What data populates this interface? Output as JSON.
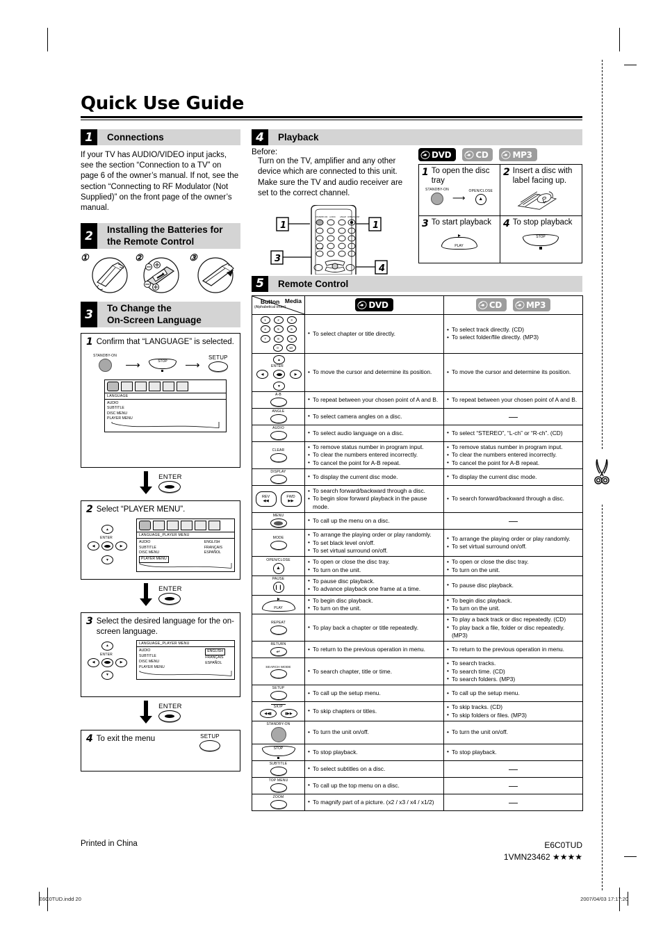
{
  "document": {
    "title": "Quick Use Guide",
    "footer_left": "Printed in China",
    "footer_model": "E6C0TUD",
    "footer_code": "1VMN23462 ★★★★",
    "print_file": "E6C0TUD.indd   20",
    "print_stamp": "2007/04/03   17:17:20"
  },
  "sections": {
    "connections": {
      "number": "1",
      "title": "Connections",
      "body": "If your TV has AUDIO/VIDEO input jacks, see the section “Connection to a TV” on page 6 of the owner’s manual. If not, see the section “Connecting to RF Modulator (Not Supplied)” on the front page of the owner’s manual."
    },
    "batteries": {
      "number": "2",
      "title_line1": "Installing the Batteries for",
      "title_line2": "the Remote Control",
      "steps": [
        "①",
        "②",
        "③"
      ]
    },
    "language": {
      "number": "3",
      "title_line1": "To Change the",
      "title_line2": "On-Screen Language",
      "step1": {
        "n": "1",
        "text": "Confirm that “LANGUAGE” is selected.",
        "key_standby": "STANDBY-ON",
        "key_stop": "STOP",
        "key_setup": "SETUP",
        "osd_bar": "LANGUAGE",
        "osd_items": [
          "AUDIO",
          "SUBTITLE",
          "DISC MENU",
          "PLAYER MENU"
        ]
      },
      "connector1": "ENTER",
      "step2": {
        "n": "2",
        "text": "Select “PLAYER MENU”.",
        "nav_enter": "ENTER",
        "osd_bar": "LANGUAGE_PLAYER MENU",
        "osd_items": [
          "AUDIO",
          "SUBTITLE",
          "DISC MENU",
          "PLAYER MENU"
        ],
        "osd_values": [
          "ENGLISH",
          "FRANÇAIS",
          "ESPAÑOL"
        ],
        "highlighted_item": "PLAYER MENU"
      },
      "connector2": "ENTER",
      "step3": {
        "n": "3",
        "text": "Select the desired language for the on-screen language.",
        "nav_enter": "ENTER",
        "osd_bar": "LANGUAGE_PLAYER MENU",
        "osd_items": [
          "AUDIO",
          "SUBTITLE",
          "DISC MENU",
          "PLAYER MENU"
        ],
        "osd_values": [
          "ENGLISH",
          "FRANÇAIS",
          "ESPAÑOL"
        ],
        "highlighted_value": "ENGLISH"
      },
      "connector3": "ENTER",
      "step4": {
        "n": "4",
        "text": "To exit the menu",
        "key_setup": "SETUP"
      }
    },
    "playback": {
      "number": "4",
      "title": "Playback",
      "before_label": "Before:",
      "before_text": "Turn on the TV, amplifier and any other device which are connected to this unit. Make sure the TV and audio receiver are set to the correct channel.",
      "callouts": [
        "1",
        "1",
        "3",
        "4"
      ],
      "logos": [
        {
          "name": "DVD",
          "style": "dvd"
        },
        {
          "name": "CD",
          "style": "grey"
        },
        {
          "name": "MP3",
          "style": "grey"
        }
      ],
      "cells": [
        {
          "n": "1",
          "text": "To open the disc tray",
          "key_a": "STANDBY-ON",
          "key_b": "OPEN/CLOSE"
        },
        {
          "n": "2",
          "text": "Insert a disc with label facing up."
        },
        {
          "n": "3",
          "text": "To start playback",
          "key": "PLAY"
        },
        {
          "n": "4",
          "text": "To stop playback",
          "key": "STOP"
        }
      ]
    },
    "remote": {
      "number": "5",
      "title": "Remote Control",
      "header": {
        "button_label": "Button",
        "button_sub": "(Alphabetical order)",
        "media_label": "Media",
        "col_dvd": "DVD",
        "col_cd": "CD",
        "col_mp3": "MP3"
      },
      "rows": [
        {
          "button": "number-keys",
          "button_label": "",
          "dvd": [
            "To select chapter or title directly."
          ],
          "cdmp3": [
            "To select track directly. (CD)",
            "To select folder/file directly. (MP3)"
          ]
        },
        {
          "button": "cursor-enter-keys",
          "button_label": "ENTER",
          "dvd": [
            "To move the cursor and determine its position."
          ],
          "cdmp3": [
            "To move the cursor and determine its position."
          ]
        },
        {
          "button": "ab-key",
          "button_label": "A-B",
          "dvd": [
            "To repeat between your chosen point of A and B."
          ],
          "cdmp3": [
            "To repeat between your chosen point of A and B."
          ]
        },
        {
          "button": "angle-key",
          "button_label": "ANGLE",
          "dvd": [
            "To select camera angles on a disc."
          ],
          "cdmp3": "—"
        },
        {
          "button": "audio-key",
          "button_label": "AUDIO",
          "dvd": [
            "To select audio language on a disc."
          ],
          "cdmp3": [
            "To select “STEREO”, “L-ch” or “R-ch”. (CD)"
          ]
        },
        {
          "button": "clear-key",
          "button_label": "CLEAR",
          "dvd": [
            "To remove status number in program input.",
            "To clear the numbers entered incorrectly.",
            "To cancel the point for A-B repeat."
          ],
          "cdmp3": [
            "To remove status number in program input.",
            "To clear the numbers entered incorrectly.",
            "To cancel the point for A-B repeat."
          ]
        },
        {
          "button": "display-key",
          "button_label": "DISPLAY",
          "dvd": [
            "To display the current disc mode."
          ],
          "cdmp3": [
            "To display the current disc mode."
          ]
        },
        {
          "button": "rev-fwd-keys",
          "button_label": "REV / FWD",
          "dvd": [
            "To search forward/backward through a disc.",
            "To begin slow forward playback in the pause mode."
          ],
          "cdmp3": [
            "To search forward/backward through a disc."
          ]
        },
        {
          "button": "menu-key",
          "button_label": "MENU",
          "dvd": [
            "To call up the menu on a disc."
          ],
          "cdmp3": "—"
        },
        {
          "button": "mode-key",
          "button_label": "MODE",
          "dvd": [
            "To arrange the playing order or play randomly.",
            "To set black level on/off.",
            "To set virtual surround on/off."
          ],
          "cdmp3": [
            "To arrange the playing order or play randomly.",
            "To set virtual surround on/off."
          ]
        },
        {
          "button": "open-close-key",
          "button_label": "OPEN/CLOSE",
          "dvd": [
            "To open or close the disc tray.",
            "To turn on the unit."
          ],
          "cdmp3": [
            "To open or close the disc tray.",
            "To turn on the unit."
          ]
        },
        {
          "button": "pause-key",
          "button_label": "PAUSE",
          "dvd": [
            "To pause disc playback.",
            "To advance playback one frame at a time."
          ],
          "cdmp3": [
            "To pause disc playback."
          ]
        },
        {
          "button": "play-key",
          "button_label": "PLAY",
          "dvd": [
            "To begin disc playback.",
            "To turn on the unit."
          ],
          "cdmp3": [
            "To begin disc playback.",
            "To turn on the unit."
          ]
        },
        {
          "button": "repeat-key",
          "button_label": "REPEAT",
          "dvd": [
            "To play back a chapter or title repeatedly."
          ],
          "cdmp3": [
            "To play a back track or disc repeatedly. (CD)",
            "To play back a file, folder or disc repeatedly. (MP3)"
          ]
        },
        {
          "button": "return-key",
          "button_label": "RETURN",
          "dvd": [
            "To return to the previous operation in menu."
          ],
          "cdmp3": [
            "To return to the previous operation in menu."
          ]
        },
        {
          "button": "search-mode-key",
          "button_label": "SEARCH MODE",
          "dvd": [
            "To search chapter, title or time."
          ],
          "cdmp3": [
            "To search tracks.",
            "To search time. (CD)",
            "To search folders. (MP3)"
          ]
        },
        {
          "button": "setup-key",
          "button_label": "SETUP",
          "dvd": [
            "To call up the setup menu."
          ],
          "cdmp3": [
            "To call up the setup menu."
          ]
        },
        {
          "button": "skip-keys",
          "button_label": "SKIP",
          "dvd": [
            "To skip chapters or titles."
          ],
          "cdmp3": [
            "To skip tracks. (CD)",
            "To skip folders or files. (MP3)"
          ]
        },
        {
          "button": "standby-on-key",
          "button_label": "STANDBY-ON",
          "dvd": [
            "To turn the unit on/off."
          ],
          "cdmp3": [
            "To turn the unit on/off."
          ]
        },
        {
          "button": "stop-key",
          "button_label": "STOP",
          "dvd": [
            "To stop playback."
          ],
          "cdmp3": [
            "To stop playback."
          ]
        },
        {
          "button": "subtitle-key",
          "button_label": "SUBTITLE",
          "dvd": [
            "To select subtitles on a disc."
          ],
          "cdmp3": "—"
        },
        {
          "button": "top-menu-key",
          "button_label": "TOP MENU",
          "dvd": [
            "To call up the top menu on a disc."
          ],
          "cdmp3": "—"
        },
        {
          "button": "zoom-key",
          "button_label": "ZOOM",
          "dvd": [
            "To magnify part of a picture. (x2 / x3 / x4 / x1/2)"
          ],
          "cdmp3": "—"
        }
      ]
    }
  },
  "colors": {
    "section_num_bg": "#000000",
    "section_title_bg": "#d4d4d4",
    "logo_dvd_bg": "#000000",
    "logo_grey_bg": "#9d9d9d",
    "standby_button": "#a8a8a8"
  }
}
